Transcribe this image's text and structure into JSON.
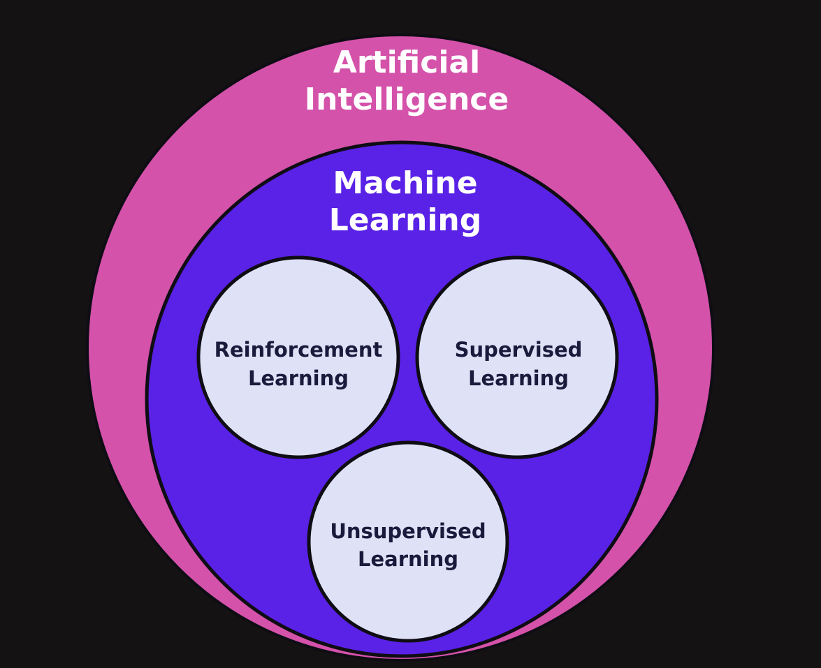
{
  "colors": {
    "background": "#141213",
    "ai_fill": "#d452aa",
    "ml_fill": "#5a21e6",
    "subset_fill": "#dfe1f7",
    "outline": "#0f0d14",
    "outer_text": "#ffffff",
    "inner_text": "#1c1a3c"
  },
  "diagram": {
    "ai": {
      "line1": "Artificial",
      "line2": "Intelligence"
    },
    "ml": {
      "line1": "Machine",
      "line2": "Learning"
    },
    "reinforcement": {
      "line1": "Reinforcement",
      "line2": "Learning"
    },
    "supervised": {
      "line1": "Supervised",
      "line2": "Learning"
    },
    "unsupervised": {
      "line1": "Unsupervised",
      "line2": "Learning"
    }
  }
}
